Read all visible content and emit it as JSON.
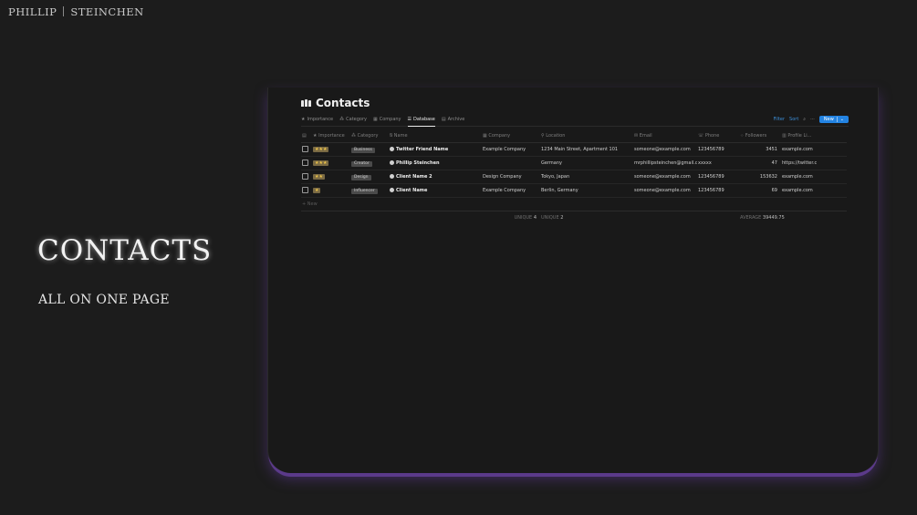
{
  "brand": {
    "first": "PHILLIP",
    "last": "STEINCHEN"
  },
  "hero": {
    "title": "CONTACTS",
    "subtitle": "ALL ON ONE PAGE"
  },
  "app": {
    "title": "Contacts",
    "tabs": [
      {
        "label": "Importance",
        "icon": "star-icon"
      },
      {
        "label": "Category",
        "icon": "shapes-icon"
      },
      {
        "label": "Company",
        "icon": "building-icon"
      },
      {
        "label": "Database",
        "icon": "database-icon",
        "active": true
      },
      {
        "label": "Archive",
        "icon": "archive-icon"
      }
    ],
    "toolbar": {
      "filter": "Filter",
      "sort": "Sort",
      "new": "New"
    },
    "columns": {
      "importance": "Importance",
      "category": "Category",
      "name": "Name",
      "company": "Company",
      "location": "Location",
      "email": "Email",
      "phone": "Phone",
      "followers": "Followers",
      "profile": "Profile Li..."
    },
    "rows": [
      {
        "importance": "★★★",
        "category": "Business",
        "name": "Twitter Friend Name",
        "company": "Example Company",
        "location": "1234 Main Street, Apartment 101",
        "email": "someone@example.com",
        "phone": "123456789",
        "followers": "3451",
        "profile": "example.com"
      },
      {
        "importance": "★★★",
        "category": "Creator",
        "name": "Phillip Steinchen",
        "company": "",
        "location": "Germany",
        "email": "mrphillipsteinchen@gmail.co",
        "phone": "xxxxx",
        "followers": "47",
        "profile": "https://twitter.c"
      },
      {
        "importance": "★★",
        "category": "Design",
        "name": "Client Name 2",
        "company": "Design Company",
        "location": "Tokyo, Japan",
        "email": "someone@example.com",
        "phone": "123456789",
        "followers": "153632",
        "profile": "example.com"
      },
      {
        "importance": "★",
        "category": "Influencer",
        "name": "Client Name",
        "company": "Example Company",
        "location": "Berlin, Germany",
        "email": "someone@example.com",
        "phone": "123456789",
        "followers": "69",
        "profile": "example.com"
      }
    ],
    "new_row": "+ New",
    "footer": {
      "company_label": "UNIQUE",
      "company_value": "4",
      "location_label": "UNIQUE",
      "location_value": "2",
      "followers_label": "AVERAGE",
      "followers_value": "39449.75"
    }
  }
}
